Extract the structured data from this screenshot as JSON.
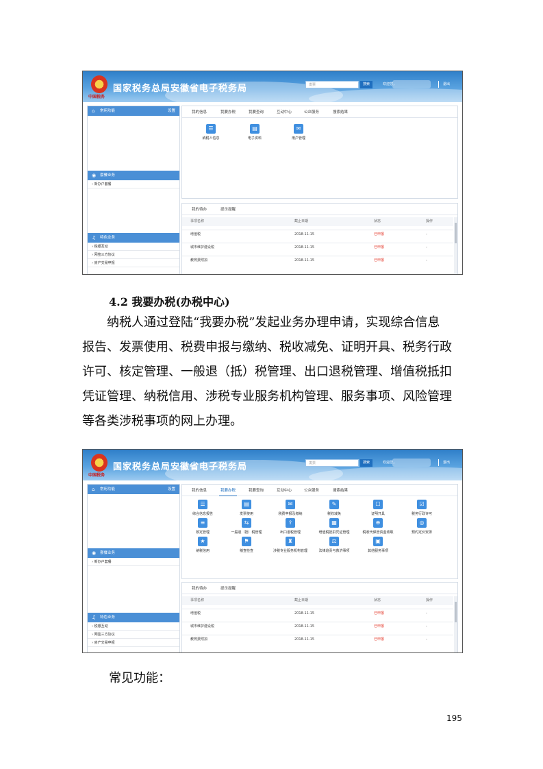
{
  "header": {
    "logo_text": "中国税务",
    "title": "国家税务总局安徽省电子税务局",
    "search_placeholder": "发票",
    "search_button": "搜索",
    "user_label": "欢迎您，",
    "exit_label": "退出"
  },
  "sidebar": {
    "common": {
      "title": "常用功能",
      "settings": "设置"
    },
    "advisory": {
      "title": "套餐业务",
      "items": [
        "新办户套餐"
      ]
    },
    "special": {
      "title": "特色业务",
      "items": [
        "税银互动",
        "网签三方协议",
        "房产交易申报"
      ]
    }
  },
  "screenshot1": {
    "tabs": [
      "我的信息",
      "我要办税",
      "我要查询",
      "互动中心",
      "公众服务",
      "搜索结果"
    ],
    "active_tab": 0,
    "functions": [
      "纳税人信息",
      "电子资料",
      "用户管理"
    ]
  },
  "screenshot2": {
    "tabs": [
      "我的信息",
      "我要办税",
      "我要查询",
      "互动中心",
      "公众服务",
      "搜索结果"
    ],
    "active_tab": 1,
    "functions": [
      "综合信息报告",
      "发票使用",
      "税费申报及缴纳",
      "税收减免",
      "证明开具",
      "税务行政许可",
      "核定管理",
      "一般退（抵）税管理",
      "出口退税管理",
      "增值税抵扣凭证管理",
      "税收代保管资金收取",
      "预约定价安排",
      "纳税信用",
      "稽查检查",
      "涉税专业服务机构管理",
      "法律追责与救济事项",
      "其他服务事项"
    ]
  },
  "todo": {
    "tabs": [
      "我的待办",
      "提示提醒"
    ],
    "headers": [
      "事项名称",
      "截止日期",
      "状态",
      "操作"
    ],
    "rows": [
      {
        "name": "增值税",
        "date": "2018-11-15",
        "status": "已申报",
        "op": "-"
      },
      {
        "name": "城市维护建设税",
        "date": "2018-11-15",
        "status": "已申报",
        "op": "-"
      },
      {
        "name": "教育费附加",
        "date": "2018-11-15",
        "status": "已申报",
        "op": "-"
      }
    ]
  },
  "doc": {
    "section_title": "4.2 我要办税(办税中心)",
    "paragraph_lines": [
      "纳税人通过登陆“我要办税”发起业务办理申请，实现综合信息",
      "报告、发票使用、税费申报与缴纳、税收减免、证明开具、税务行政",
      "许可、核定管理、一般退（抵）税管理、出口退税管理、增值税抵扣",
      "凭证管理、纳税信用、涉税专业服务机构管理、服务事项、风险管理",
      "等各类涉税事项的网上办理。"
    ],
    "common_functions_label": "常见功能：",
    "page_number": "195"
  }
}
